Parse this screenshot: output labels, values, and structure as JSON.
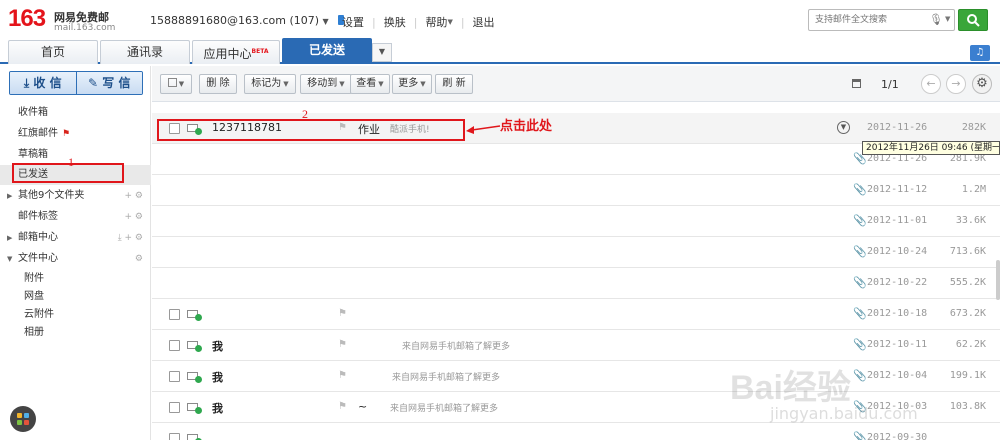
{
  "header": {
    "logo_num": "163",
    "logo_name": "网易免费邮",
    "logo_domain": "mail.163.com",
    "account": "15888891680@163.com (107)",
    "nav": [
      "设置",
      "换肤",
      "帮助",
      "退出"
    ],
    "search_placeholder": "支持邮件全文搜索"
  },
  "tabs": [
    {
      "label": "首页"
    },
    {
      "label": "通讯录"
    },
    {
      "label": "应用中心",
      "badge": "BETA"
    },
    {
      "label": "已发送",
      "active": true
    }
  ],
  "sidebar": {
    "receive_label": "收 信",
    "write_label": "写 信",
    "items": [
      {
        "label": "收件箱"
      },
      {
        "label": "红旗邮件"
      },
      {
        "label": "草稿箱"
      },
      {
        "label": "已发送",
        "active": true
      },
      {
        "label": "其他9个文件夹"
      },
      {
        "label": "邮件标签"
      },
      {
        "label": "邮箱中心"
      },
      {
        "label": "文件中心"
      }
    ],
    "file_center_items": [
      "附件",
      "网盘",
      "云附件",
      "相册"
    ]
  },
  "toolbar": {
    "delete": "删 除",
    "mark_as": "标记为",
    "move_to": "移动到",
    "view": "查看",
    "more": "更多",
    "refresh": "刷 新",
    "pager": "1/1"
  },
  "emails": [
    {
      "sender": "1237118781",
      "subject": "作业",
      "preview": "酷派手机!",
      "date": "2012-11-26",
      "size": "282K",
      "attachment": false,
      "highlighted": true
    },
    {
      "sender": "",
      "subject": "",
      "preview": "",
      "date": "2012-11-26",
      "size": "281.9K",
      "attachment": true
    },
    {
      "sender": "",
      "subject": "",
      "preview": "",
      "date": "2012-11-12",
      "size": "1.2M",
      "attachment": true
    },
    {
      "sender": "",
      "subject": "",
      "preview": "",
      "date": "2012-11-01",
      "size": "33.6K",
      "attachment": true
    },
    {
      "sender": "",
      "subject": "",
      "preview": "",
      "date": "2012-10-24",
      "size": "713.6K",
      "attachment": true
    },
    {
      "sender": "",
      "subject": "",
      "preview": "",
      "date": "2012-10-22",
      "size": "555.2K",
      "attachment": true
    },
    {
      "sender": "",
      "subject": "",
      "preview": "",
      "date": "2012-10-18",
      "size": "673.2K",
      "attachment": true
    },
    {
      "sender": "我",
      "subject": "",
      "preview": "来自网易手机邮箱了解更多",
      "date": "2012-10-11",
      "size": "62.2K",
      "attachment": true
    },
    {
      "sender": "我",
      "subject": "",
      "preview": "来自网易手机邮箱了解更多",
      "date": "2012-10-04",
      "size": "199.1K",
      "attachment": true
    },
    {
      "sender": "我",
      "subject": "~",
      "preview": "来自网易手机邮箱了解更多",
      "date": "2012-10-03",
      "size": "103.8K",
      "attachment": true
    },
    {
      "sender": "",
      "subject": "",
      "preview": "",
      "date": "2012-09-30",
      "size": "",
      "attachment": true
    }
  ],
  "tooltip": "2012年11月26日 09:46 (星期一)",
  "annotations": {
    "num1": "1",
    "num2": "2",
    "text": "点击此处"
  },
  "watermark": {
    "main": "Bai经验",
    "sub": "jingyan.baidu.com"
  }
}
